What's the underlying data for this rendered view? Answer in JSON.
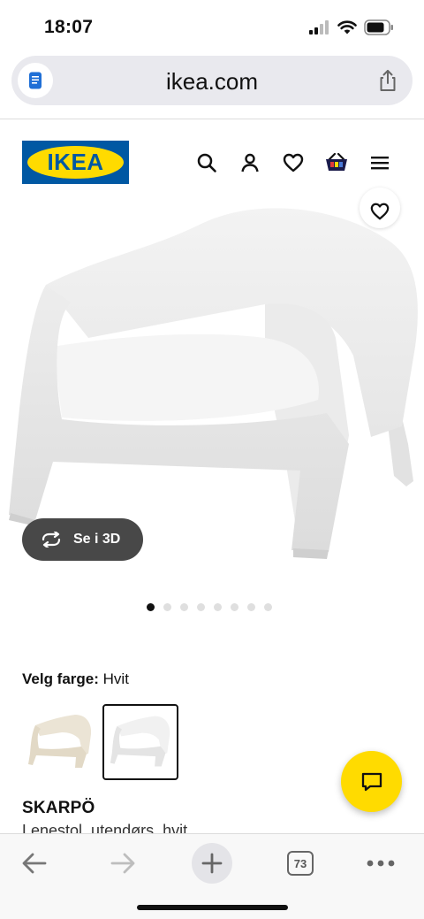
{
  "status": {
    "time": "18:07"
  },
  "browser": {
    "url": "ikea.com",
    "tab_count": "73"
  },
  "header": {
    "logo_text": "IKEA",
    "icons": [
      "search-icon",
      "user-icon",
      "heart-icon",
      "shopping-bag-icon",
      "menu-icon"
    ]
  },
  "product": {
    "view_3d_label": "Se i 3D",
    "gallery_total": 8,
    "gallery_active": 1,
    "color_label": "Velg farge:",
    "color_value": "Hvit",
    "swatches": [
      "beige",
      "white"
    ],
    "selected_swatch": "white",
    "name": "SKARPÖ",
    "description": "Lenestol, utendørs, hvit"
  },
  "colors": {
    "brand_blue": "#0058a3",
    "brand_yellow": "#ffdb00",
    "button_dark": "#484848"
  }
}
